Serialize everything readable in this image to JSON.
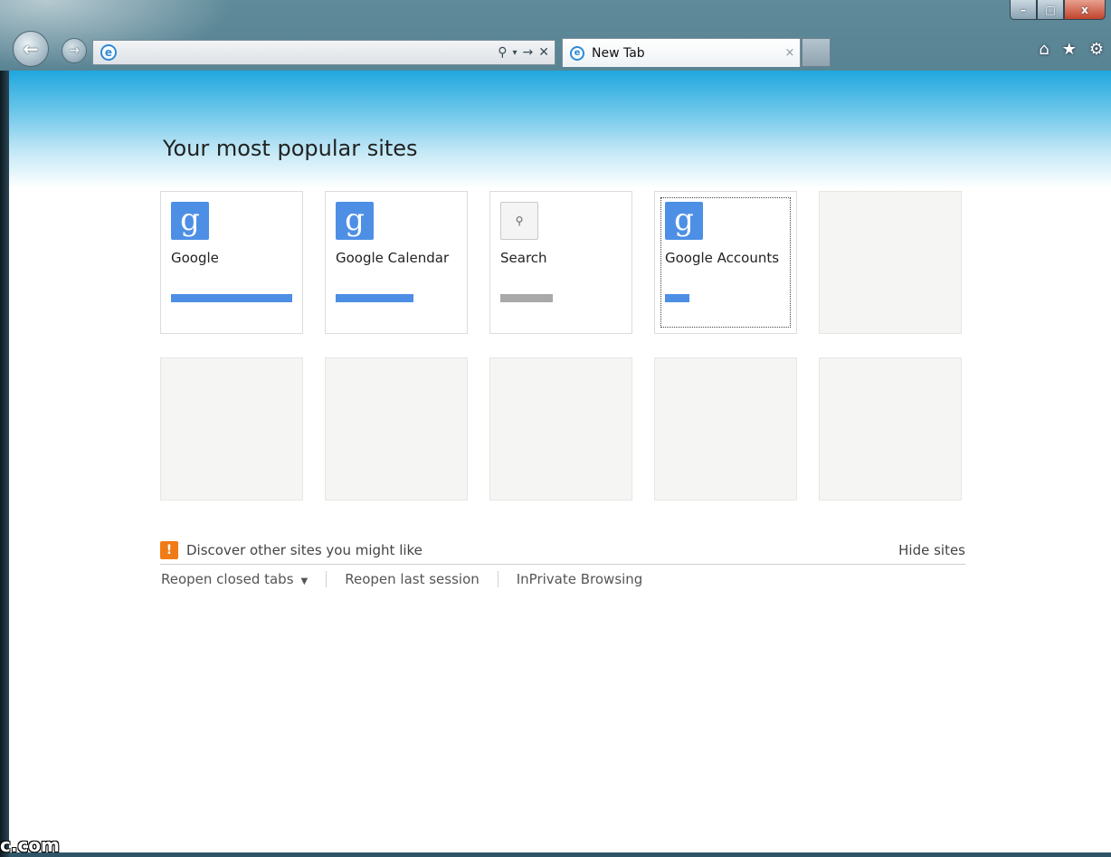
{
  "window": {
    "caption": {
      "minimize": "–",
      "maximize": "□",
      "close": "x"
    }
  },
  "toolbar": {
    "back_glyph": "←",
    "forward_glyph": "→",
    "address_value": "",
    "search_glyph": "⚲",
    "dropdown_glyph": "▾",
    "go_glyph": "→",
    "stop_glyph": "✕",
    "tab_title": "New Tab",
    "tab_close": "×",
    "home_glyph": "⌂",
    "favorites_glyph": "★",
    "tools_glyph": "⚙"
  },
  "page": {
    "title": "Your most popular sites",
    "tiles": [
      {
        "label": "Google",
        "icon": "g",
        "usage": 1.0,
        "bar_color": "#4d8fe5"
      },
      {
        "label": "Google Calendar",
        "icon": "g",
        "usage": 0.64,
        "bar_color": "#4d8fe5"
      },
      {
        "label": "Search",
        "icon": "search",
        "usage": 0.43,
        "bar_color": "#a9a9a9"
      },
      {
        "label": "Google Accounts",
        "icon": "g",
        "usage": 0.2,
        "bar_color": "#4d8fe5"
      }
    ],
    "discover_text": "Discover other sites you might like",
    "discover_icon": "!",
    "hide_sites": "Hide sites",
    "reopen_closed_tabs": "Reopen closed tabs",
    "reopen_last_session": "Reopen last session",
    "inprivate": "InPrivate Browsing",
    "dropdown_arrow": "▼"
  },
  "watermark": "c.com"
}
